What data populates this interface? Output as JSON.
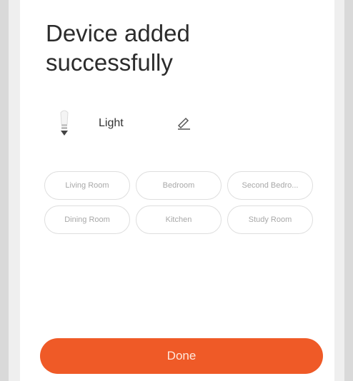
{
  "header": {
    "title": "Device added successfully"
  },
  "device": {
    "name": "Light",
    "icon": "light-bulb-icon",
    "edit_icon": "pencil-icon"
  },
  "rooms": [
    {
      "label": "Living Room"
    },
    {
      "label": "Bedroom"
    },
    {
      "label": "Second Bedro..."
    },
    {
      "label": "Dining Room"
    },
    {
      "label": "Kitchen"
    },
    {
      "label": "Study Room"
    }
  ],
  "footer": {
    "done_label": "Done"
  },
  "colors": {
    "accent": "#ef5a27",
    "chip_border": "#dedede",
    "chip_text": "#a8a8a8"
  }
}
